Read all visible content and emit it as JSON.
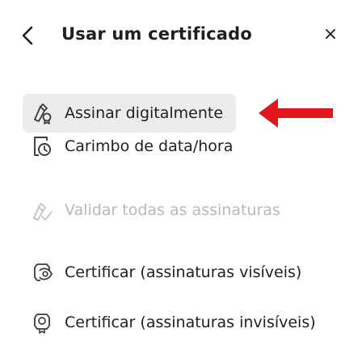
{
  "header": {
    "title": "Usar um certificado",
    "close_glyph": "×"
  },
  "menu": {
    "items": [
      {
        "label": "Assinar digitalmente",
        "icon": "sign-pen-icon",
        "enabled": true,
        "highlighted": true
      },
      {
        "label": "Carimbo de data/hora",
        "icon": "timestamp-icon",
        "enabled": true
      },
      {
        "label": "Validar todas as assinaturas",
        "icon": "validate-signatures-icon",
        "enabled": false
      },
      {
        "label": "Certificar (assinaturas visíveis)",
        "icon": "certify-visible-icon",
        "enabled": true
      },
      {
        "label": "Certificar (assinaturas invisíveis)",
        "icon": "certify-invisible-icon",
        "enabled": true
      }
    ]
  },
  "annotation": {
    "arrow_color": "#e5151d"
  }
}
